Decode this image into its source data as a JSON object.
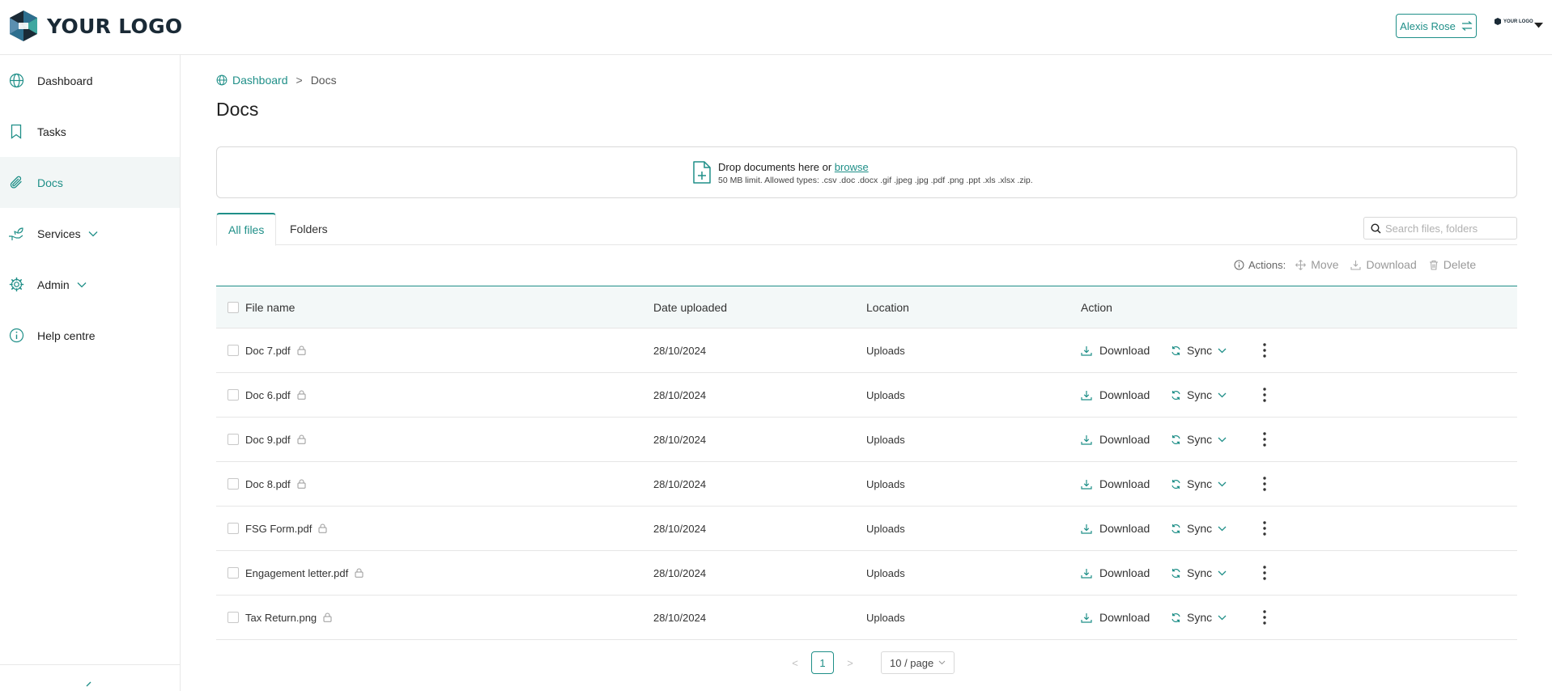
{
  "app": {
    "logo_text": "YOUR LOGO",
    "mini_logo_text": "YOUR LOGO",
    "accent_color": "#1f8f88"
  },
  "header": {
    "user_name": "Alexis Rose",
    "switch_icon": "swap-arrows-icon"
  },
  "sidebar": {
    "items": [
      {
        "label": "Dashboard",
        "icon": "globe-icon"
      },
      {
        "label": "Tasks",
        "icon": "bookmark-icon"
      },
      {
        "label": "Docs",
        "icon": "paperclip-icon",
        "active": true
      },
      {
        "label": "Services",
        "icon": "hand-plant-icon",
        "expandable": true
      },
      {
        "label": "Admin",
        "icon": "gear-icon",
        "expandable": true
      },
      {
        "label": "Help centre",
        "icon": "info-icon"
      }
    ]
  },
  "breadcrumb": {
    "home": "Dashboard",
    "separator": ">",
    "current": "Docs"
  },
  "page": {
    "title": "Docs"
  },
  "dropzone": {
    "text": "Drop documents here or ",
    "link": "browse",
    "limits": "50 MB limit. Allowed types: .csv .doc .docx .gif .jpeg .jpg .pdf .png .ppt .xls .xlsx .zip."
  },
  "tabs": [
    {
      "label": "All files",
      "active": true
    },
    {
      "label": "Folders",
      "active": false
    }
  ],
  "search": {
    "placeholder": "Search files, folders"
  },
  "bulk_actions": {
    "label": "Actions:",
    "move": "Move",
    "download": "Download",
    "delete": "Delete"
  },
  "table": {
    "columns": {
      "name": "File name",
      "date": "Date uploaded",
      "location": "Location",
      "action": "Action"
    },
    "row_actions": {
      "download": "Download",
      "sync": "Sync"
    },
    "rows": [
      {
        "name": "Doc 7.pdf",
        "date": "28/10/2024",
        "location": "Uploads"
      },
      {
        "name": "Doc 6.pdf",
        "date": "28/10/2024",
        "location": "Uploads"
      },
      {
        "name": "Doc 9.pdf",
        "date": "28/10/2024",
        "location": "Uploads"
      },
      {
        "name": "Doc 8.pdf",
        "date": "28/10/2024",
        "location": "Uploads"
      },
      {
        "name": "FSG Form.pdf",
        "date": "28/10/2024",
        "location": "Uploads"
      },
      {
        "name": "Engagement letter.pdf",
        "date": "28/10/2024",
        "location": "Uploads"
      },
      {
        "name": "Tax Return.png",
        "date": "28/10/2024",
        "location": "Uploads"
      }
    ]
  },
  "pagination": {
    "current_page": "1",
    "page_size": "10 / page",
    "prev": "<",
    "next": ">"
  }
}
